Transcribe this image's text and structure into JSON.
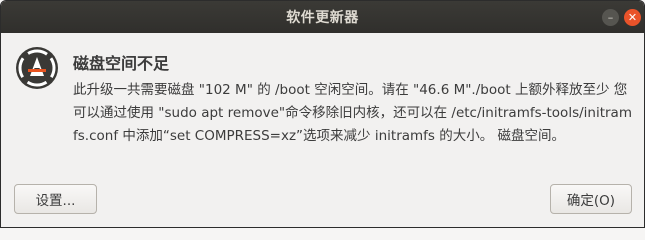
{
  "window": {
    "title": "软件更新器",
    "minimize_glyph": "–",
    "close_glyph": "✕",
    "accent_close_color": "#e9532a"
  },
  "icon": "software-updater-icon",
  "message": {
    "title": "磁盘空间不足",
    "body": "此升级一共需要磁盘 \"102 M\" 的 /boot 空闲空间。请在 \"46.6 M\"./boot 上额外释放至少 您可以通过使用 \"sudo apt remove\"命令移除旧内核，还可以在 /etc/initramfs-tools/initramfs.conf 中添加“set COMPRESS=xz”选项来减少 initramfs 的大小。 磁盘空间。"
  },
  "buttons": {
    "settings_label": "设置...",
    "ok_label": "确定(O)"
  }
}
